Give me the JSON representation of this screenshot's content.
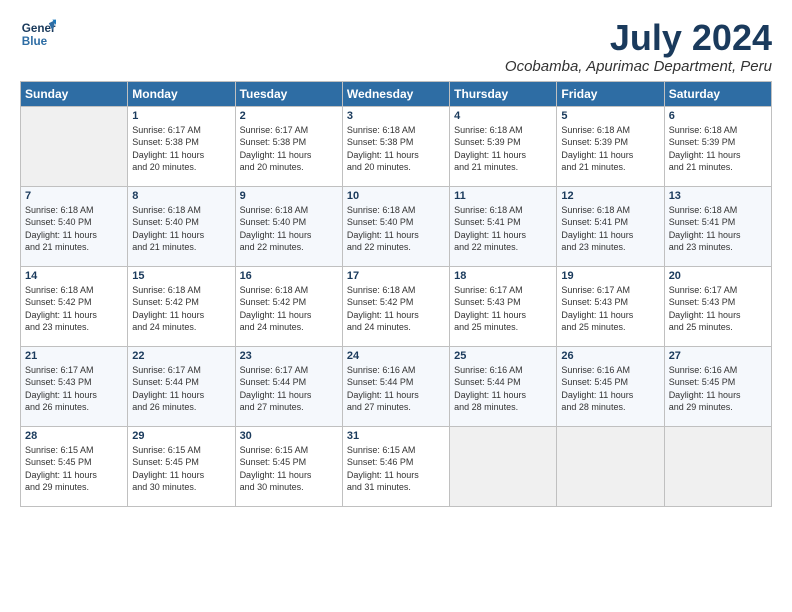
{
  "logo": {
    "line1": "General",
    "line2": "Blue"
  },
  "title": "July 2024",
  "location": "Ocobamba, Apurimac Department, Peru",
  "days_of_week": [
    "Sunday",
    "Monday",
    "Tuesday",
    "Wednesday",
    "Thursday",
    "Friday",
    "Saturday"
  ],
  "weeks": [
    [
      {
        "day": "",
        "info": ""
      },
      {
        "day": "1",
        "info": "Sunrise: 6:17 AM\nSunset: 5:38 PM\nDaylight: 11 hours\nand 20 minutes."
      },
      {
        "day": "2",
        "info": "Sunrise: 6:17 AM\nSunset: 5:38 PM\nDaylight: 11 hours\nand 20 minutes."
      },
      {
        "day": "3",
        "info": "Sunrise: 6:18 AM\nSunset: 5:38 PM\nDaylight: 11 hours\nand 20 minutes."
      },
      {
        "day": "4",
        "info": "Sunrise: 6:18 AM\nSunset: 5:39 PM\nDaylight: 11 hours\nand 21 minutes."
      },
      {
        "day": "5",
        "info": "Sunrise: 6:18 AM\nSunset: 5:39 PM\nDaylight: 11 hours\nand 21 minutes."
      },
      {
        "day": "6",
        "info": "Sunrise: 6:18 AM\nSunset: 5:39 PM\nDaylight: 11 hours\nand 21 minutes."
      }
    ],
    [
      {
        "day": "7",
        "info": "Sunrise: 6:18 AM\nSunset: 5:40 PM\nDaylight: 11 hours\nand 21 minutes."
      },
      {
        "day": "8",
        "info": "Sunrise: 6:18 AM\nSunset: 5:40 PM\nDaylight: 11 hours\nand 21 minutes."
      },
      {
        "day": "9",
        "info": "Sunrise: 6:18 AM\nSunset: 5:40 PM\nDaylight: 11 hours\nand 22 minutes."
      },
      {
        "day": "10",
        "info": "Sunrise: 6:18 AM\nSunset: 5:40 PM\nDaylight: 11 hours\nand 22 minutes."
      },
      {
        "day": "11",
        "info": "Sunrise: 6:18 AM\nSunset: 5:41 PM\nDaylight: 11 hours\nand 22 minutes."
      },
      {
        "day": "12",
        "info": "Sunrise: 6:18 AM\nSunset: 5:41 PM\nDaylight: 11 hours\nand 23 minutes."
      },
      {
        "day": "13",
        "info": "Sunrise: 6:18 AM\nSunset: 5:41 PM\nDaylight: 11 hours\nand 23 minutes."
      }
    ],
    [
      {
        "day": "14",
        "info": "Sunrise: 6:18 AM\nSunset: 5:42 PM\nDaylight: 11 hours\nand 23 minutes."
      },
      {
        "day": "15",
        "info": "Sunrise: 6:18 AM\nSunset: 5:42 PM\nDaylight: 11 hours\nand 24 minutes."
      },
      {
        "day": "16",
        "info": "Sunrise: 6:18 AM\nSunset: 5:42 PM\nDaylight: 11 hours\nand 24 minutes."
      },
      {
        "day": "17",
        "info": "Sunrise: 6:18 AM\nSunset: 5:42 PM\nDaylight: 11 hours\nand 24 minutes."
      },
      {
        "day": "18",
        "info": "Sunrise: 6:17 AM\nSunset: 5:43 PM\nDaylight: 11 hours\nand 25 minutes."
      },
      {
        "day": "19",
        "info": "Sunrise: 6:17 AM\nSunset: 5:43 PM\nDaylight: 11 hours\nand 25 minutes."
      },
      {
        "day": "20",
        "info": "Sunrise: 6:17 AM\nSunset: 5:43 PM\nDaylight: 11 hours\nand 25 minutes."
      }
    ],
    [
      {
        "day": "21",
        "info": "Sunrise: 6:17 AM\nSunset: 5:43 PM\nDaylight: 11 hours\nand 26 minutes."
      },
      {
        "day": "22",
        "info": "Sunrise: 6:17 AM\nSunset: 5:44 PM\nDaylight: 11 hours\nand 26 minutes."
      },
      {
        "day": "23",
        "info": "Sunrise: 6:17 AM\nSunset: 5:44 PM\nDaylight: 11 hours\nand 27 minutes."
      },
      {
        "day": "24",
        "info": "Sunrise: 6:16 AM\nSunset: 5:44 PM\nDaylight: 11 hours\nand 27 minutes."
      },
      {
        "day": "25",
        "info": "Sunrise: 6:16 AM\nSunset: 5:44 PM\nDaylight: 11 hours\nand 28 minutes."
      },
      {
        "day": "26",
        "info": "Sunrise: 6:16 AM\nSunset: 5:45 PM\nDaylight: 11 hours\nand 28 minutes."
      },
      {
        "day": "27",
        "info": "Sunrise: 6:16 AM\nSunset: 5:45 PM\nDaylight: 11 hours\nand 29 minutes."
      }
    ],
    [
      {
        "day": "28",
        "info": "Sunrise: 6:15 AM\nSunset: 5:45 PM\nDaylight: 11 hours\nand 29 minutes."
      },
      {
        "day": "29",
        "info": "Sunrise: 6:15 AM\nSunset: 5:45 PM\nDaylight: 11 hours\nand 30 minutes."
      },
      {
        "day": "30",
        "info": "Sunrise: 6:15 AM\nSunset: 5:45 PM\nDaylight: 11 hours\nand 30 minutes."
      },
      {
        "day": "31",
        "info": "Sunrise: 6:15 AM\nSunset: 5:46 PM\nDaylight: 11 hours\nand 31 minutes."
      },
      {
        "day": "",
        "info": ""
      },
      {
        "day": "",
        "info": ""
      },
      {
        "day": "",
        "info": ""
      }
    ]
  ]
}
